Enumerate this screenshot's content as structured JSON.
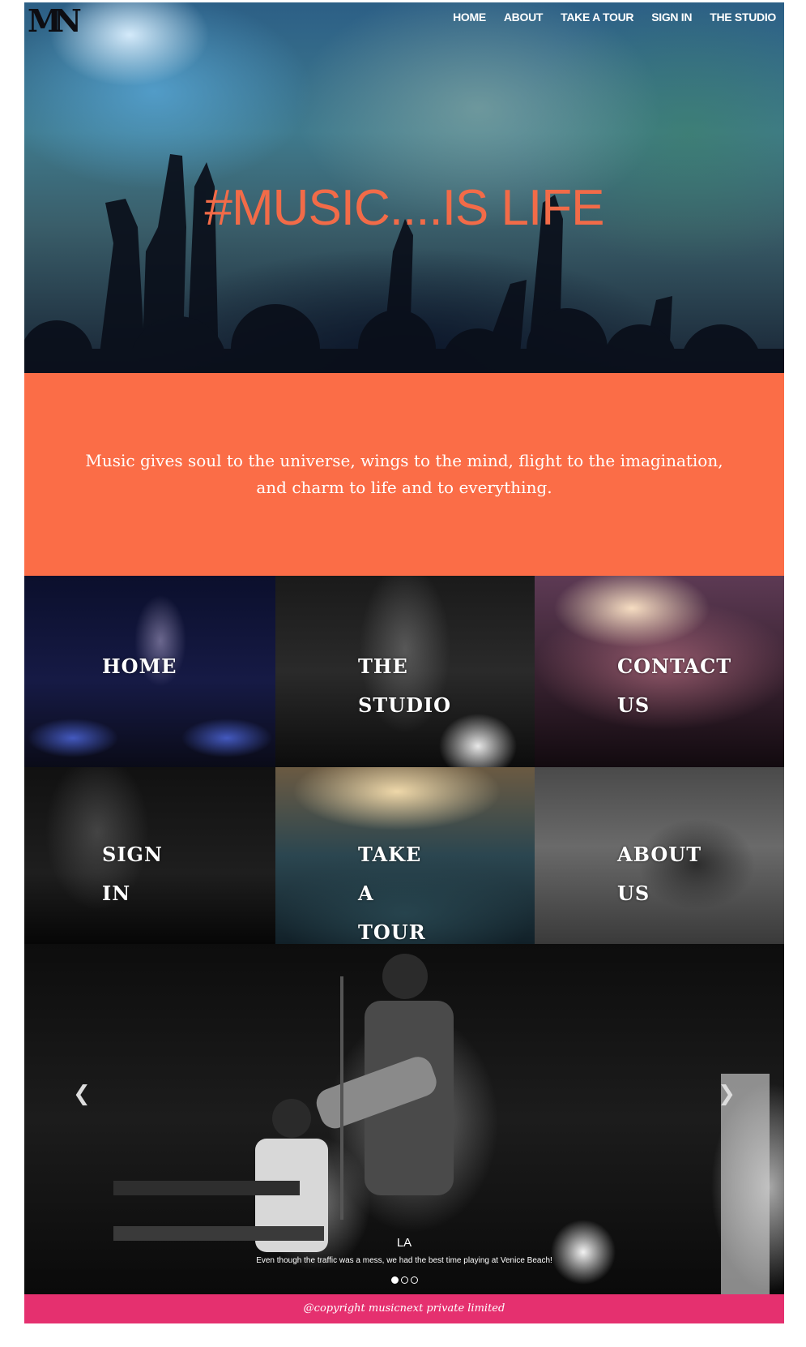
{
  "header": {
    "logo_text": "MN",
    "nav": [
      "HOME",
      "ABOUT",
      "TAKE A TOUR",
      "SIGN IN",
      "THE STUDIO"
    ]
  },
  "hero": {
    "title": "#MUSIC....IS LIFE"
  },
  "quote": {
    "text": "Music gives soul to the universe, wings to the mind, flight to the imagination, and charm to life and to everything."
  },
  "tiles": [
    "HOME",
    "THE STUDIO",
    "CONTACT US",
    "SIGN IN",
    "TAKE A TOUR",
    "ABOUT US"
  ],
  "carousel": {
    "prev_icon": "chevron-left-icon",
    "next_icon": "chevron-right-icon",
    "caption_title": "LA",
    "caption_text": "Even though the traffic was a mess, we had the best time playing at Venice Beach!",
    "indicators": 3,
    "active_index": 0
  },
  "footer": {
    "text": "@copyright musicnext private limited"
  },
  "colors": {
    "accent": "#fb6d47",
    "hero_title": "#f26b48",
    "footer": "#e5306f"
  }
}
